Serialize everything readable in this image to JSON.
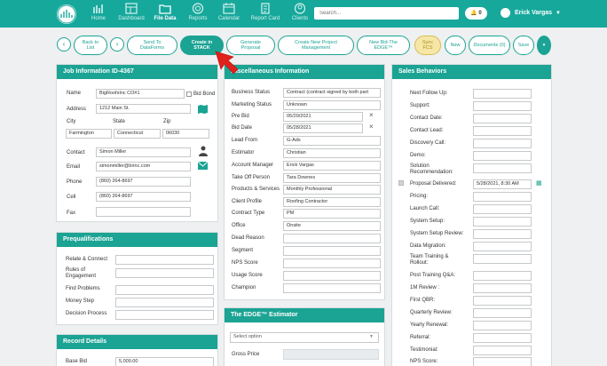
{
  "nav": {
    "items": [
      {
        "label": "Home",
        "icon": "home-icon"
      },
      {
        "label": "Dashboard",
        "icon": "dashboard-icon"
      },
      {
        "label": "File Data",
        "icon": "folder-icon"
      },
      {
        "label": "Reports",
        "icon": "reports-icon"
      },
      {
        "label": "Calendar",
        "icon": "calendar-icon"
      },
      {
        "label": "Report Card",
        "icon": "report-card-icon"
      },
      {
        "label": "Clients",
        "icon": "clients-icon"
      }
    ],
    "search_placeholder": "Search...",
    "notifications": "0",
    "user_name": "Erick Vargas"
  },
  "actions": {
    "back": "Back to List",
    "send_dataforms": "Send To DataForms",
    "create_stack": "Create in STACK",
    "generate_proposal": "Generate Proposal",
    "new_project": "Create New Project Management",
    "new_bid": "New Bid-The EDGE™",
    "sync_fcs": "Sync FCS",
    "new": "New",
    "documents": "Documents (0)",
    "save": "Save"
  },
  "job_info": {
    "title": "Job Information ID-4367",
    "name_label": "Name",
    "name_value": "BigRoofsInc CO#1",
    "bid_bond_label": "Bid Bond",
    "address_label": "Address",
    "address_value": "1212 Main St.",
    "city_label": "City",
    "state_label": "State",
    "zip_label": "Zip",
    "city_value": "Farmington",
    "state_value": "Connecticut",
    "zip_value": "06030",
    "contact_label": "Contact",
    "contact_value": "Simon Miller",
    "email_label": "Email",
    "email_value": "simonmiller@brinc.com",
    "phone_label": "Phone",
    "phone_value": "(860) 264-8697",
    "cell_label": "Cell",
    "cell_value": "(860) 264-8697",
    "fax_label": "Fax",
    "fax_value": ""
  },
  "prequal": {
    "title": "Prequalifications",
    "fields": [
      "Relate & Connect",
      "Rules of Engagement",
      "Find Problems",
      "Money Step",
      "Decision Process"
    ]
  },
  "record": {
    "title": "Record Details",
    "base_bid_label": "Base Bid",
    "base_bid_value": "5,000.00"
  },
  "misc": {
    "title": "Miscellaneous Information",
    "fields": [
      {
        "label": "Business Status",
        "value": "Contract (contract signed by both part"
      },
      {
        "label": "Marketing Status",
        "value": "Unknown"
      },
      {
        "label": "Pre Bid",
        "value": "05/20/2021"
      },
      {
        "label": "Bid Date",
        "value": "05/28/2021"
      },
      {
        "label": "Lead From",
        "value": "G-Ads"
      },
      {
        "label": "Estimator",
        "value": "Christian"
      },
      {
        "label": "Account Manager",
        "value": "Erick Vargas"
      },
      {
        "label": "Take Off Person",
        "value": "Tara Downes"
      },
      {
        "label": "Products & Services",
        "value": "Monthly Professional"
      },
      {
        "label": "Client Profile",
        "value": "Roofing Contractor"
      },
      {
        "label": "Contract Type",
        "value": "PM"
      },
      {
        "label": "Office",
        "value": "Onsite"
      },
      {
        "label": "Dead Reason",
        "value": ""
      },
      {
        "label": "Segment",
        "value": ""
      },
      {
        "label": "NPS Score",
        "value": ""
      },
      {
        "label": "Usage Score",
        "value": ""
      },
      {
        "label": "Champion",
        "value": ""
      }
    ]
  },
  "edge": {
    "title": "The EDGE™ Estimator",
    "select_placeholder": "Select option",
    "gross_price_label": "Gross Price"
  },
  "sales": {
    "title": "Sales Behaviors",
    "fields": [
      {
        "label": "Next Follow Up:",
        "value": ""
      },
      {
        "label": "Support:",
        "value": ""
      },
      {
        "label": "Contact Date:",
        "value": ""
      },
      {
        "label": "Contact Lead:",
        "value": ""
      },
      {
        "label": "Discovery Call:",
        "value": ""
      },
      {
        "label": "Demo:",
        "value": ""
      },
      {
        "label": "Solution Recommendation:",
        "value": ""
      },
      {
        "label": "Proposal Delivered:",
        "value": "5/28/2021, 8:30 AM"
      },
      {
        "label": "Pricing:",
        "value": ""
      },
      {
        "label": "Launch Call:",
        "value": ""
      },
      {
        "label": "System Setup:",
        "value": ""
      },
      {
        "label": "System Setup Review:",
        "value": ""
      },
      {
        "label": "Data Migration:",
        "value": ""
      },
      {
        "label": "Team Training & Rollout:",
        "value": ""
      },
      {
        "label": "Post Training Q&A:",
        "value": ""
      },
      {
        "label": "1M Review :",
        "value": ""
      },
      {
        "label": "First QBR:",
        "value": ""
      },
      {
        "label": "Quarterly Review:",
        "value": ""
      },
      {
        "label": "Yearly Renewal:",
        "value": ""
      },
      {
        "label": "Referral:",
        "value": ""
      },
      {
        "label": "Testimonial:",
        "value": ""
      },
      {
        "label": "NPS Score:",
        "value": ""
      }
    ]
  },
  "colors": {
    "brand": "#1ba394",
    "pointer": "#e0211b"
  }
}
